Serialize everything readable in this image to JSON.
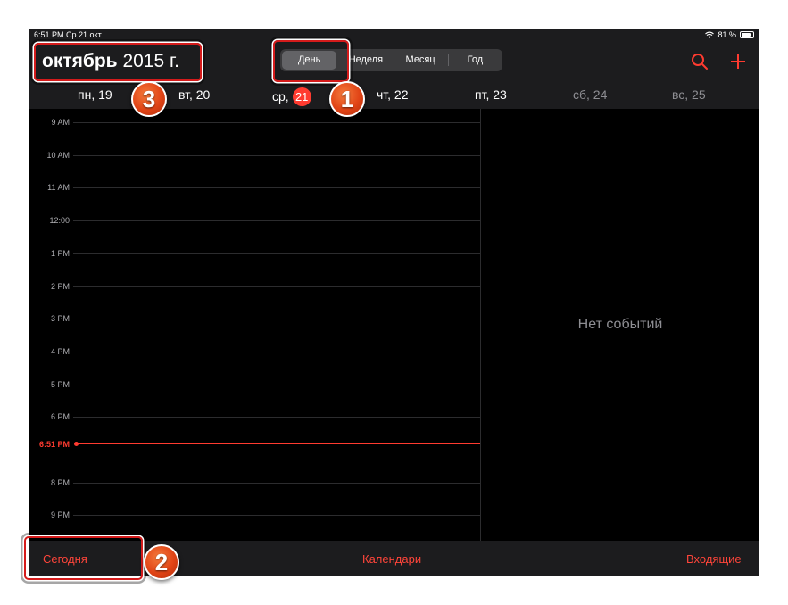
{
  "status": {
    "time_date": "6:51 PM  Ср 21 окт.",
    "battery_text": "81 %",
    "battery_level": 0.81
  },
  "header": {
    "month_bold": "октябрь",
    "year": "2015 г."
  },
  "view_switcher": {
    "options": [
      "День",
      "Неделя",
      "Месяц",
      "Год"
    ],
    "selected": "День"
  },
  "week_days": [
    {
      "label": "пн, 19"
    },
    {
      "label": "вт, 20"
    },
    {
      "label": "ср,",
      "badge": "21"
    },
    {
      "label": "чт, 22"
    },
    {
      "label": "пт, 23"
    },
    {
      "label": "сб, 24"
    },
    {
      "label": "вс, 25"
    }
  ],
  "timeline": {
    "hours": [
      "9 AM",
      "10 AM",
      "11 AM",
      "12:00",
      "1 PM",
      "2 PM",
      "3 PM",
      "4 PM",
      "5 PM",
      "6 PM",
      "8 PM",
      "9 PM"
    ],
    "current_time": "6:51 PM"
  },
  "empty_state": "Нет событий",
  "toolbar": {
    "today": "Сегодня",
    "calendars": "Календари",
    "inbox": "Входящие"
  },
  "annotations": [
    "1",
    "2",
    "3"
  ],
  "colors": {
    "accent": "#ff3b30",
    "toolbar_text": "#ff453a",
    "highlight": "#d51b1b"
  }
}
